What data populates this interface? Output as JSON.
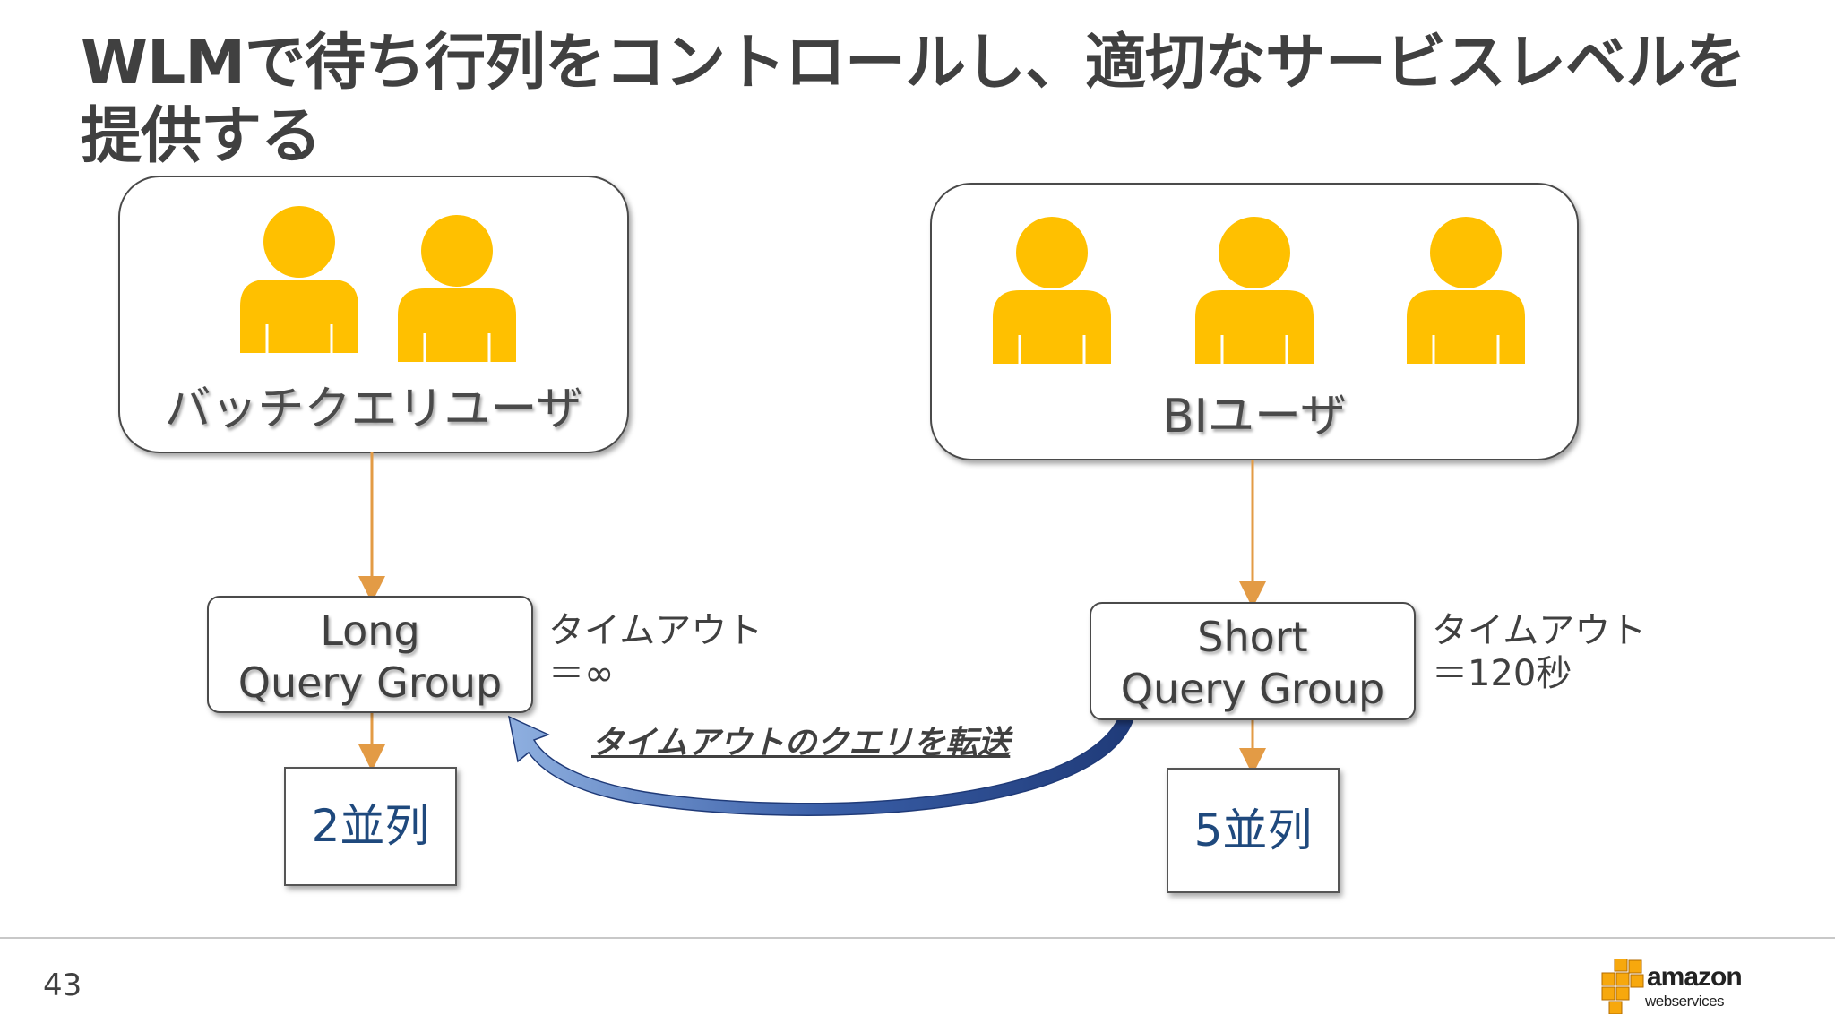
{
  "slide": {
    "title": "WLMで待ち行列をコントロールし、適切なサービスレベルを提供する",
    "page_number": "43"
  },
  "groups": {
    "batch": {
      "label": "バッチクエリユーザ",
      "user_count": 2
    },
    "bi": {
      "label": "BIユーザ",
      "user_count": 3
    }
  },
  "queues": {
    "long": {
      "line1": "Long",
      "line2": "Query Group",
      "concurrency": "2並列",
      "timeout_label": "タイムアウト",
      "timeout_value": "＝∞"
    },
    "short": {
      "line1": "Short",
      "line2": "Query Group",
      "concurrency": "5並列",
      "timeout_label": "タイムアウト",
      "timeout_value": "＝120秒"
    }
  },
  "transfer": {
    "label": "タイムアウトのクエリを転送"
  },
  "logo": {
    "word": "amazon",
    "sub": "webservices"
  },
  "colors": {
    "user_icon": "#FFC000",
    "arrow": "#E39B45",
    "transfer_arrow": "#2F4D8A",
    "concurrency_text": "#1F497D"
  }
}
